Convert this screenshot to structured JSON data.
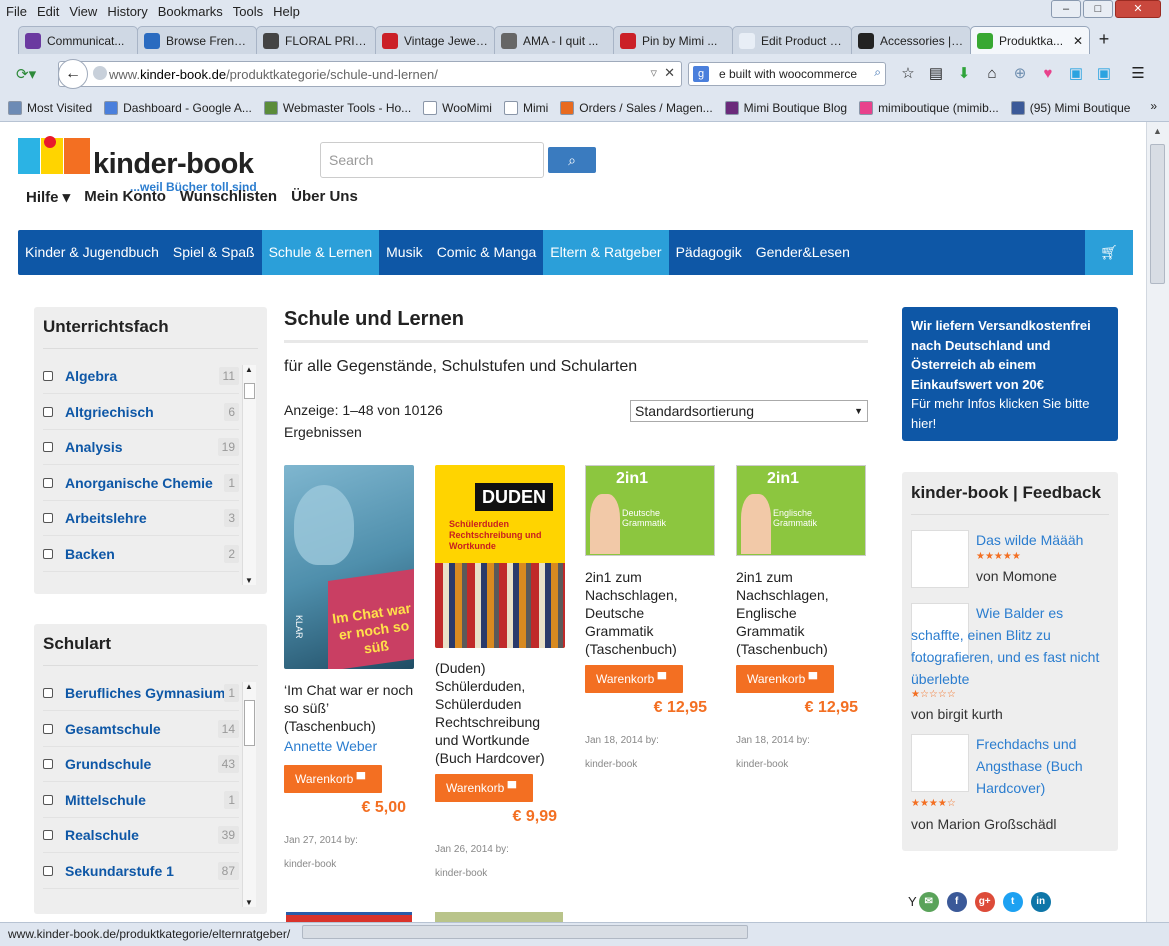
{
  "browser": {
    "menu": [
      "File",
      "Edit",
      "View",
      "History",
      "Bookmarks",
      "Tools",
      "Help"
    ],
    "tabs": [
      {
        "label": "Communicat...",
        "icon_color": "#6b3aa0",
        "icon": "peace-icon"
      },
      {
        "label": "Browse Frenc...",
        "icon_color": "#2a6bc0",
        "icon": "drop-icon"
      },
      {
        "label": "FLORAL PRIN...",
        "icon_color": "#444",
        "icon": "frame-icon"
      },
      {
        "label": "Vintage Jewel...",
        "icon_color": "#cb2027",
        "icon": "pinterest-icon"
      },
      {
        "label": "AMA - I quit ...",
        "icon_color": "#666",
        "icon": "reddit-icon"
      },
      {
        "label": "Pin by Mimi ...",
        "icon_color": "#cb2027",
        "icon": "pinterest-icon"
      },
      {
        "label": "Edit Product ‹ Mi...",
        "icon_color": "#e8eef6",
        "icon": "blank-icon"
      },
      {
        "label": "Accessories | ...",
        "icon_color": "#222",
        "icon": "shop-icon"
      },
      {
        "label": "Produktka...",
        "icon_color": "#38a832",
        "icon": "loading-icon"
      }
    ],
    "url": "www.kinder-book.de/produktkategorie/schule-und-lernen/",
    "url_domain": "kinder-book.de",
    "search_text": "e built with woocommerce",
    "bookmarks": [
      {
        "label": "Most Visited",
        "color": "#6d8bb5"
      },
      {
        "label": "Dashboard - Google A...",
        "color": "#4a7fdc"
      },
      {
        "label": "Webmaster Tools - Ho...",
        "color": "#5b8c3a"
      },
      {
        "label": "WooMimi",
        "color": "#fff"
      },
      {
        "label": "Mimi",
        "color": "#fff"
      },
      {
        "label": "Orders / Sales / Magen...",
        "color": "#e86a1f"
      },
      {
        "label": "Mimi Boutique Blog",
        "color": "#6a2a7a"
      },
      {
        "label": "mimiboutique (mimib...",
        "color": "#e8428c"
      },
      {
        "label": "(95) Mimi Boutique",
        "color": "#3b5998"
      }
    ],
    "status_url": "www.kinder-book.de/produktkategorie/elternratgeber/"
  },
  "site": {
    "logo_title": "kinder-book",
    "logo_tagline": "...weil Bücher toll sind",
    "search_placeholder": "Search",
    "top_nav": [
      "Hilfe ▾",
      "Mein Konto",
      "Wunschlisten",
      "Über Uns"
    ],
    "categories": [
      {
        "label": "Kinder & Jugendbuch",
        "highlight": false
      },
      {
        "label": "Spiel & Spaß",
        "highlight": false
      },
      {
        "label": "Schule & Lernen",
        "highlight": true
      },
      {
        "label": "Musik",
        "highlight": false
      },
      {
        "label": "Comic & Manga",
        "highlight": false
      },
      {
        "label": "Eltern & Ratgeber",
        "highlight": true
      },
      {
        "label": "Pädagogik",
        "highlight": false
      },
      {
        "label": "Gender&Lesen",
        "highlight": false
      }
    ],
    "colors": {
      "primary": "#0e57a6",
      "accent": "#2b9fd9",
      "orange": "#f36f22"
    }
  },
  "sidebar": {
    "subject": {
      "title": "Unterrichtsfach",
      "items": [
        {
          "label": "Algebra",
          "count": "11"
        },
        {
          "label": "Altgriechisch",
          "count": "6"
        },
        {
          "label": "Analysis",
          "count": "19"
        },
        {
          "label": "Anorganische Chemie",
          "count": "1"
        },
        {
          "label": "Arbeitslehre",
          "count": "3"
        },
        {
          "label": "Backen",
          "count": "2"
        }
      ]
    },
    "school": {
      "title": "Schulart",
      "items": [
        {
          "label": "Berufliches Gymnasium",
          "count": "1"
        },
        {
          "label": "Gesamtschule",
          "count": "14"
        },
        {
          "label": "Grundschule",
          "count": "43"
        },
        {
          "label": "Mittelschule",
          "count": "1"
        },
        {
          "label": "Realschule",
          "count": "39"
        },
        {
          "label": "Sekundarstufe 1",
          "count": "87"
        }
      ]
    }
  },
  "main": {
    "title": "Schule und Lernen",
    "subtitle": "für alle Gegenstände, Schulstufen und Schularten",
    "result_count": "Anzeige: 1–48 von 10126 Ergebnissen",
    "sort_selected": "Standardsortierung",
    "cart_label": "Warenkorb",
    "products": [
      {
        "title": "‘Im Chat war er noch so süß’ (Taschenbuch)",
        "author": "Annette Weber",
        "price": "€ 5,00",
        "date": "Jan 27, 2014 by:",
        "by": "kinder-book",
        "cover_text": "Im Chat war er noch so süß",
        "cover_series": "KLAR"
      },
      {
        "title": "(Duden) Schülerduden, Schülerduden Rechtschreibung und Wortkunde (Buch Hardcover)",
        "author": "",
        "price": "€ 9,99",
        "date": "Jan 26, 2014 by:",
        "by": "kinder-book",
        "cover_text": "Schülerduden Rechtschreibung und Wortkunde",
        "cover_series": "DUDEN"
      },
      {
        "title": "2in1 zum Nachschlagen, Deutsche Grammatik (Taschenbuch)",
        "author": "",
        "price": "€ 12,95",
        "date": "Jan 18, 2014 by:",
        "by": "kinder-book",
        "cover_text": "Deutsche Grammatik",
        "cover_series": "2in1"
      },
      {
        "title": "2in1 zum Nachschlagen, Englische Grammatik (Taschenbuch)",
        "author": "",
        "price": "€ 12,95",
        "date": "Jan 18, 2014 by:",
        "by": "kinder-book",
        "cover_text": "Englische Grammatik",
        "cover_series": "2in1"
      }
    ]
  },
  "right": {
    "promo_bold": "Wir liefern Versandkostenfrei nach Deutschland und Österreich ab einem Einkaufswert von 20€",
    "promo_text": "Für mehr Infos klicken Sie bitte hier!",
    "feedback_title": "kinder-book | Feedback",
    "feedback": [
      {
        "title": "Das wilde Määäh",
        "rating": 5,
        "by": "von Momone"
      },
      {
        "title": "Wie Balder es schaffte, einen Blitz zu fotografieren, und es fast nicht überlebte",
        "rating": 1,
        "by": "von birgit kurth"
      },
      {
        "title": "Frechdachs und Angsthase (Buch Hardcover)",
        "rating": 4,
        "by": "von Marion Großschädl"
      }
    ],
    "social_prefix": "Y"
  }
}
